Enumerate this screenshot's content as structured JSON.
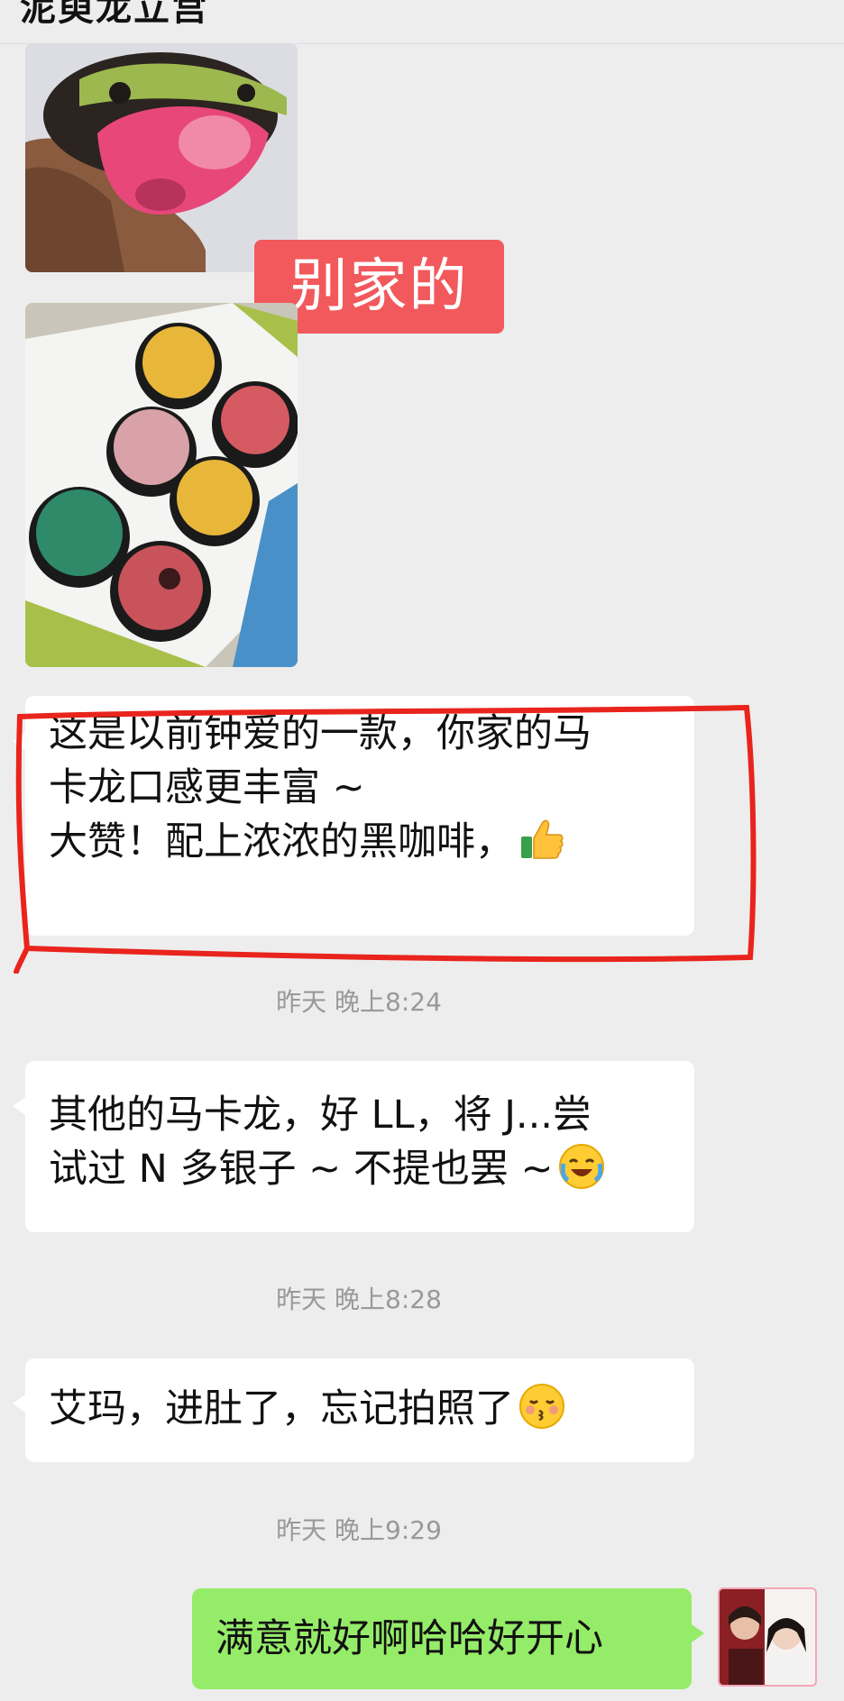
{
  "header": {
    "title": "泥萸龙立宫"
  },
  "overlay_tag": "别家的",
  "messages": [
    {
      "lines": [
        "这是以前钟爱的一款，你家的马",
        "卡龙口感更丰富 ~",
        "大赞！配上浓浓的黑咖啡，"
      ],
      "emoji": "thumbs-up-icon"
    },
    {
      "lines": [
        "其他的马卡龙，好 LL，将 J...尝",
        "试过 N 多银子 ~ 不提也罢 ~"
      ],
      "emoji": "laughing-crying-face-icon"
    },
    {
      "lines": [
        "艾玛，进肚了，忘记拍照了"
      ],
      "emoji": "kissing-face-icon"
    },
    {
      "lines": [
        "满意就好啊哈哈好开心"
      ]
    }
  ],
  "timestamps": [
    "昨天 晚上8:24",
    "昨天 晚上8:28",
    "昨天 晚上9:29"
  ],
  "colors": {
    "background": "#ededed",
    "bubble_other": "#ffffff",
    "bubble_self": "#95ec69",
    "tag": "#f2595c",
    "annotation": "#e8241c"
  }
}
